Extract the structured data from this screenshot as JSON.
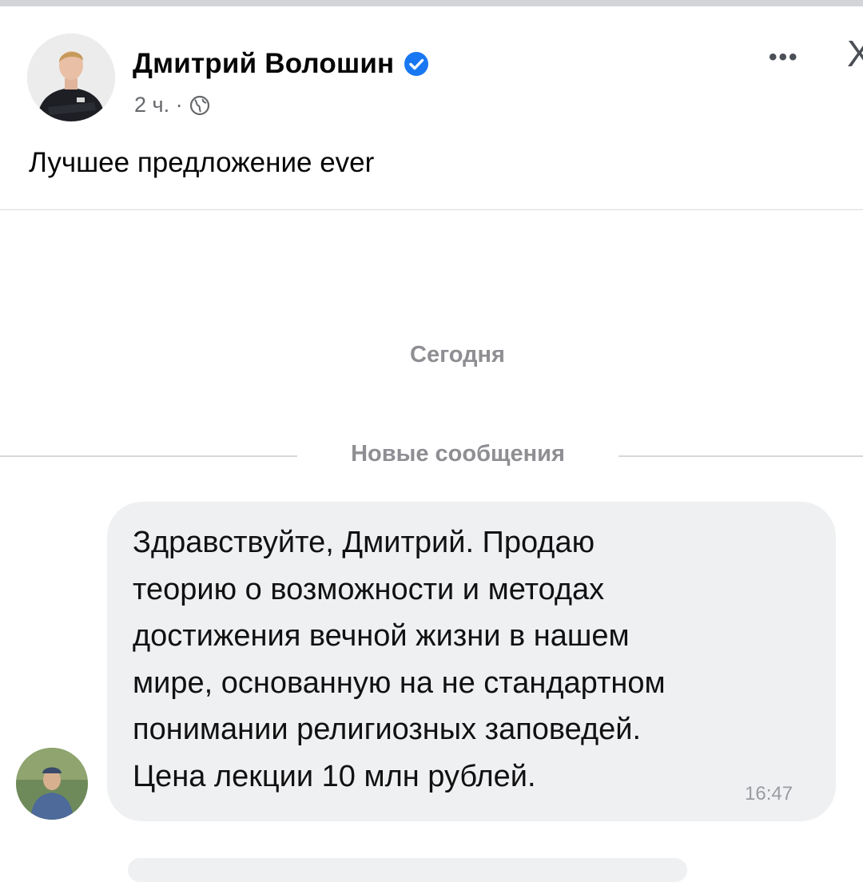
{
  "post": {
    "author_name": "Дмитрий Волошин",
    "time": "2 ч. ·",
    "text": "Лучшее предложение ever",
    "more_label": "•••",
    "close_label": "X"
  },
  "chat": {
    "date_label": "Сегодня",
    "new_messages_label": "Новые сообщения",
    "message": {
      "text": "Здравствуйте, Дмитрий. Продаю\nтеорию о возможности и методах\nдостижения вечной жизни в нашем\nмире, основанную на не стандартном\nпонимании религиозных заповедей.\nЦена лекции 10 млн рублей.",
      "time": "16:47"
    }
  },
  "colors": {
    "verified_blue": "#1877f2",
    "bubble_bg": "#eff0f2",
    "secondary_text": "#65676b",
    "system_text": "#8e8e93"
  },
  "icons": {
    "verified": "verified-badge-icon",
    "audience": "globe-icon",
    "more": "more-horizontal-icon",
    "close": "close-icon"
  }
}
